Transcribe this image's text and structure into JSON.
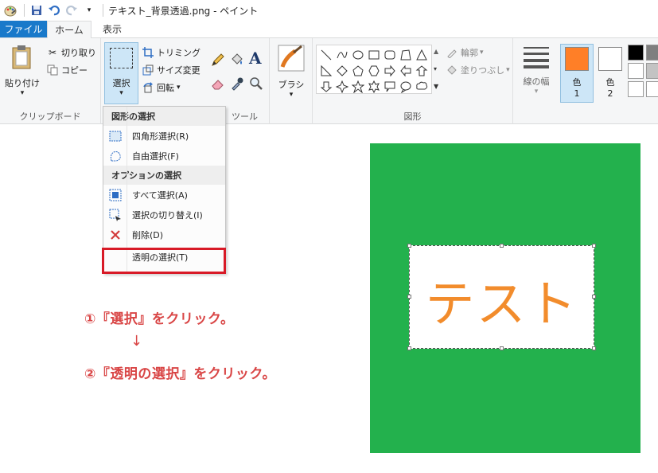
{
  "window": {
    "title": "テキスト_背景透過.png - ペイント"
  },
  "tabs": {
    "file": "ファイル",
    "home": "ホーム",
    "view": "表示"
  },
  "clipboard": {
    "paste": "貼り付け",
    "cut": "切り取り",
    "copy": "コピー",
    "group_label": "クリップボード"
  },
  "image": {
    "select": "選択",
    "crop": "トリミング",
    "resize": "サイズ変更",
    "rotate": "回転"
  },
  "tools": {
    "group_label": "ツール",
    "text_glyph": "A"
  },
  "brush": {
    "label": "ブラシ"
  },
  "shapes": {
    "outline": "輪郭",
    "fill": "塗りつぶし",
    "group_label": "図形"
  },
  "size": {
    "label": "線の幅"
  },
  "colors": {
    "color1_label": "色",
    "color1_num": "1",
    "color2_label": "色",
    "color2_num": "2",
    "color1_value": "#ff7f27",
    "color2_value": "#ffffff",
    "palette": [
      "#000000",
      "#7f7f7f",
      "#ffffff",
      "#c3c3c3",
      "#ffffff",
      "#ffffff"
    ]
  },
  "select_menu": {
    "section1": "図形の選択",
    "rect_select": "四角形選択(R)",
    "free_select": "自由選択(F)",
    "section2": "オプションの選択",
    "select_all": "すべて選択(A)",
    "invert_select": "選択の切り替え(I)",
    "delete": "削除(D)",
    "transparent_select": "透明の選択(T)"
  },
  "annotations": {
    "step1": "①『選択』をクリック。",
    "arrow": "↓",
    "step2": "②『透明の選択』をクリック。"
  },
  "canvas": {
    "background_color": "#23b14d",
    "text": "テスト",
    "text_color": "#f28c2c"
  }
}
